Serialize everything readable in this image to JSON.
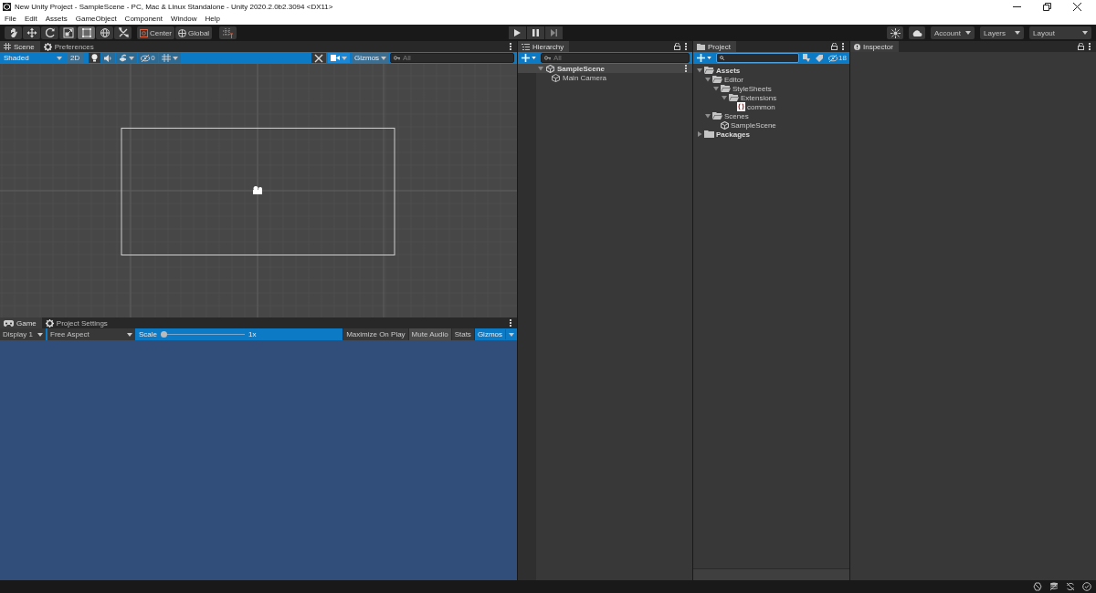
{
  "window": {
    "title": "New Unity Project - SampleScene - PC, Mac & Linux Standalone - Unity 2020.2.0b2.3094 <DX11>"
  },
  "menu": [
    "File",
    "Edit",
    "Assets",
    "GameObject",
    "Component",
    "Window",
    "Help"
  ],
  "toolbar": {
    "tools": [
      {
        "kind": "hand",
        "selected": false
      },
      {
        "kind": "move",
        "selected": false
      },
      {
        "kind": "rotate",
        "selected": false
      },
      {
        "kind": "scale",
        "selected": false
      },
      {
        "kind": "rect",
        "selected": true
      },
      {
        "kind": "transform",
        "selected": false
      },
      {
        "kind": "custom",
        "selected": false
      }
    ],
    "pivot": "Center",
    "space": "Global",
    "account": "Account",
    "layers": "Layers",
    "layout": "Layout"
  },
  "scene": {
    "tabs": [
      {
        "label": "Scene",
        "kind": "grid",
        "selected": true
      },
      {
        "label": "Preferences",
        "kind": "gear",
        "selected": false
      }
    ],
    "shading": "Shaded",
    "mode_2d": {
      "label": "2D",
      "on": false
    },
    "lighting": {
      "on": true
    },
    "grid": {
      "on": false
    },
    "tools": {
      "on": true
    },
    "hidden_count": "0",
    "gizmos": "Gizmos",
    "search": {
      "placeholder": "All"
    }
  },
  "game": {
    "tabs": [
      {
        "label": "Game",
        "kind": "gamepad",
        "selected": true
      },
      {
        "label": "Project Settings",
        "kind": "gear",
        "selected": false
      }
    ],
    "display": "Display 1",
    "aspect": "Free Aspect",
    "scale": {
      "label": "Scale",
      "level": 0,
      "reading": "1x"
    },
    "toggles": [
      {
        "label": "Maximize On Play",
        "on": false
      },
      {
        "label": "Mute Audio",
        "on": true
      },
      {
        "label": "Stats",
        "on": false
      }
    ],
    "gizmos": {
      "label": "Gizmos",
      "on": true
    }
  },
  "hierarchy": {
    "tab": "Hierarchy",
    "search": {
      "placeholder": "All"
    },
    "scene": "SampleScene",
    "items": [
      "Main Camera"
    ]
  },
  "project": {
    "tab": "Project",
    "hidden_count": "18",
    "tree": [
      {
        "label": "Assets",
        "kind": "folder",
        "expanded": true,
        "children": [
          {
            "label": "Editor",
            "kind": "folder",
            "expanded": true,
            "children": [
              {
                "label": "StyleSheets",
                "kind": "folder",
                "expanded": true,
                "children": [
                  {
                    "label": "Extensions",
                    "kind": "folder",
                    "expanded": true,
                    "children": [
                      {
                        "label": "common",
                        "kind": "stylesheet"
                      }
                    ]
                  }
                ]
              }
            ]
          },
          {
            "label": "Scenes",
            "kind": "folder",
            "expanded": true,
            "children": [
              {
                "label": "SampleScene",
                "kind": "scene"
              }
            ]
          }
        ]
      },
      {
        "label": "Packages",
        "kind": "folder",
        "expanded": false
      }
    ]
  },
  "inspector": {
    "tab": "Inspector"
  }
}
